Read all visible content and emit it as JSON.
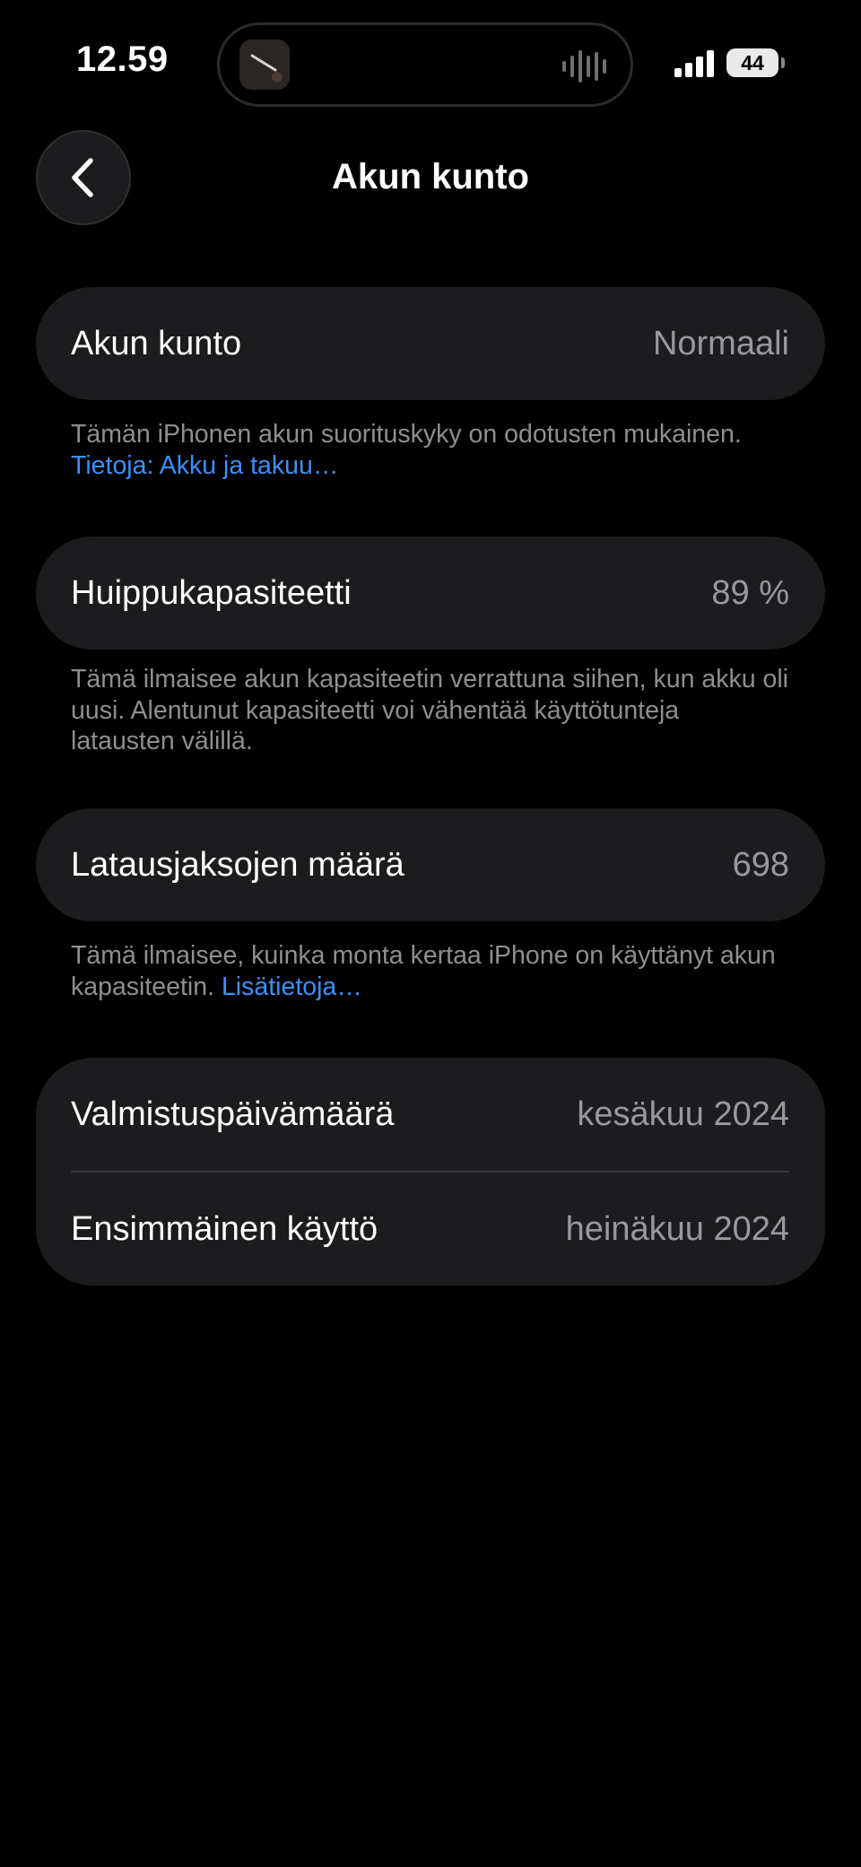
{
  "status_bar": {
    "time": "12.59",
    "battery": "44"
  },
  "nav": {
    "title": "Akun kunto"
  },
  "battery_health": {
    "label": "Akun kunto",
    "value": "Normaali",
    "note": "Tämän iPhonen akun suorituskyky on odotusten mukainen.",
    "note_link": "Tietoja: Akku ja takuu…"
  },
  "peak_capacity": {
    "label": "Huippukapasiteetti",
    "value": "89 %",
    "note": "Tämä ilmaisee akun kapasiteetin verrattuna siihen, kun akku oli uusi. Alentunut kapasiteetti voi vähentää käyttötunteja latausten välillä."
  },
  "cycle_count": {
    "label": "Latausjaksojen määrä",
    "value": "698",
    "note": "Tämä ilmaisee, kuinka monta kertaa iPhone on käyttänyt akun kapasiteetin.",
    "note_link": "Lisätietoja…"
  },
  "dates": {
    "manufacture_label": "Valmistuspäivämäärä",
    "manufacture_value": "kesäkuu 2024",
    "first_use_label": "Ensimmäinen käyttö",
    "first_use_value": "heinäkuu 2024"
  },
  "colors": {
    "background": "#000000",
    "card": "#1c1c1e",
    "secondary_text": "#98989f",
    "link": "#3e8ff7"
  }
}
